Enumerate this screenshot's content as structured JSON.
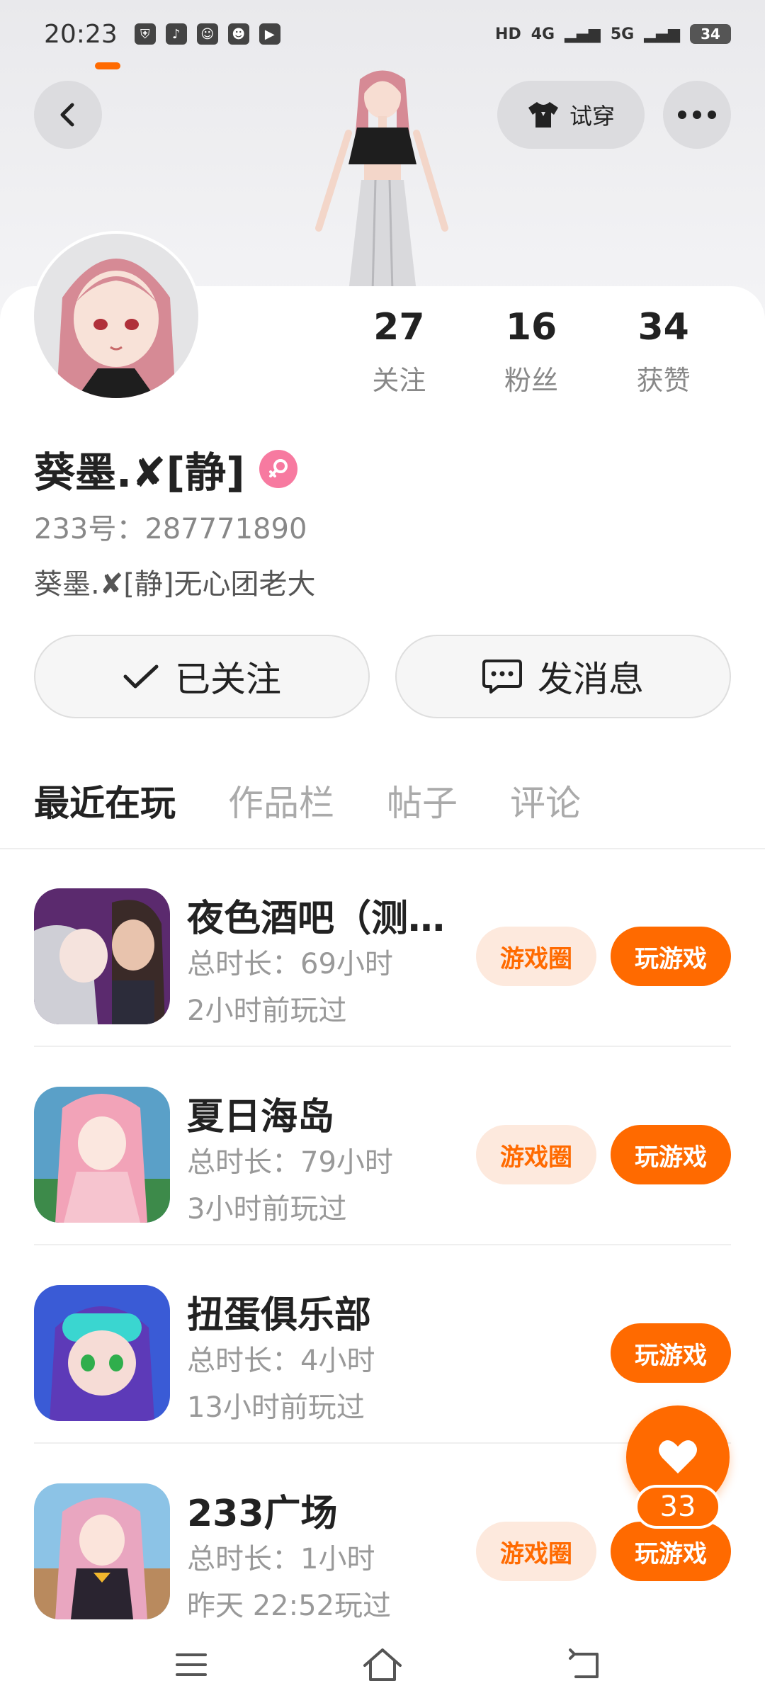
{
  "status_bar": {
    "time": "20:23",
    "network1": "4G",
    "network2": "5G",
    "hd_label": "HD",
    "battery": "34"
  },
  "header": {
    "tryon_label": "试穿"
  },
  "stats": [
    {
      "value": "27",
      "label": "关注"
    },
    {
      "value": "16",
      "label": "粉丝"
    },
    {
      "value": "34",
      "label": "获赞"
    }
  ],
  "profile": {
    "username": "葵墨.✘[静]",
    "uid": "233号：287771890",
    "bio": "葵墨.✘[静]无心团老大"
  },
  "actions": {
    "follow_label": "已关注",
    "message_label": "发消息"
  },
  "tabs": [
    {
      "label": "最近在玩"
    },
    {
      "label": "作品栏"
    },
    {
      "label": "帖子"
    },
    {
      "label": "评论"
    }
  ],
  "games": [
    {
      "title": "夜色酒吧（测…",
      "duration": "总时长：69小时",
      "last_played": "2小时前玩过",
      "circle_label": "游戏圈",
      "play_label": "玩游戏"
    },
    {
      "title": "夏日海岛",
      "duration": "总时长：79小时",
      "last_played": "3小时前玩过",
      "circle_label": "游戏圈",
      "play_label": "玩游戏"
    },
    {
      "title": "扭蛋俱乐部",
      "duration": "总时长：4小时",
      "last_played": "13小时前玩过",
      "circle_label": "",
      "play_label": "玩游戏"
    },
    {
      "title": "233广场",
      "duration": "总时长：1小时",
      "last_played": "昨天 22:52玩过",
      "circle_label": "游戏圈",
      "play_label": "玩游戏"
    }
  ],
  "like": {
    "count": "33"
  },
  "colors": {
    "accent": "#ff6a00",
    "accent_light": "#fde9dd",
    "female_badge": "#f77aa0"
  }
}
